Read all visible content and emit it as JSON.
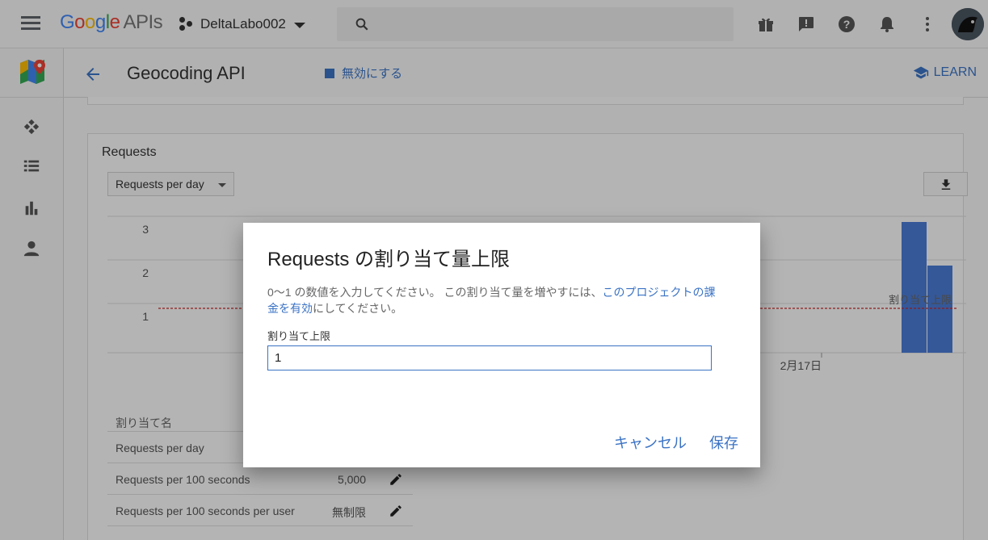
{
  "header": {
    "logo_letters": [
      "G",
      "o",
      "o",
      "g",
      "l",
      "e"
    ],
    "logo_suffix": "APIs",
    "project_name": "DeltaLabo002",
    "icons": [
      "menu-icon",
      "project-icon",
      "search-icon",
      "gift-icon",
      "feedback-icon",
      "help-icon",
      "notifications-icon",
      "more-vert-icon",
      "avatar"
    ]
  },
  "sidebar": {
    "icons": [
      "google-maps-logo",
      "dashboard-icon",
      "list-icon",
      "bar-chart-icon",
      "person-icon"
    ]
  },
  "page": {
    "title": "Geocoding API",
    "disable_label": "無効にする",
    "learn_label": "LEARN"
  },
  "requests_card": {
    "title": "Requests",
    "selector_value": "Requests per day"
  },
  "chart_data": {
    "type": "bar",
    "yticks": [
      "3",
      "2",
      "1"
    ],
    "ylim": [
      0,
      3
    ],
    "x_visible_label": "2月17日",
    "quota_line": {
      "value": 1,
      "label": "割り当て上限",
      "color": "#c62828"
    },
    "bars": [
      {
        "value": 3
      },
      {
        "value": 2
      }
    ],
    "bar_color": "#4a7bd4"
  },
  "quota_table": {
    "header": "割り当て名",
    "rows": [
      {
        "name": "Requests per day",
        "value": ""
      },
      {
        "name": "Requests per 100 seconds",
        "value": "5,000"
      },
      {
        "name": "Requests per 100 seconds per user",
        "value": "無制限"
      }
    ]
  },
  "dialog": {
    "title": "Requests の割り当て量上限",
    "desc_before": "0〜1 の数値を入力してください。 この割り当て量を増やすには、",
    "desc_link": "このプロジェクトの課金を有効",
    "desc_after": "にしてください。",
    "field_label": "割り当て上限",
    "field_value": "1",
    "cancel_label": "キャンセル",
    "save_label": "保存"
  },
  "colors": {
    "accent": "#3b73c4",
    "quota_line": "#c62828"
  }
}
